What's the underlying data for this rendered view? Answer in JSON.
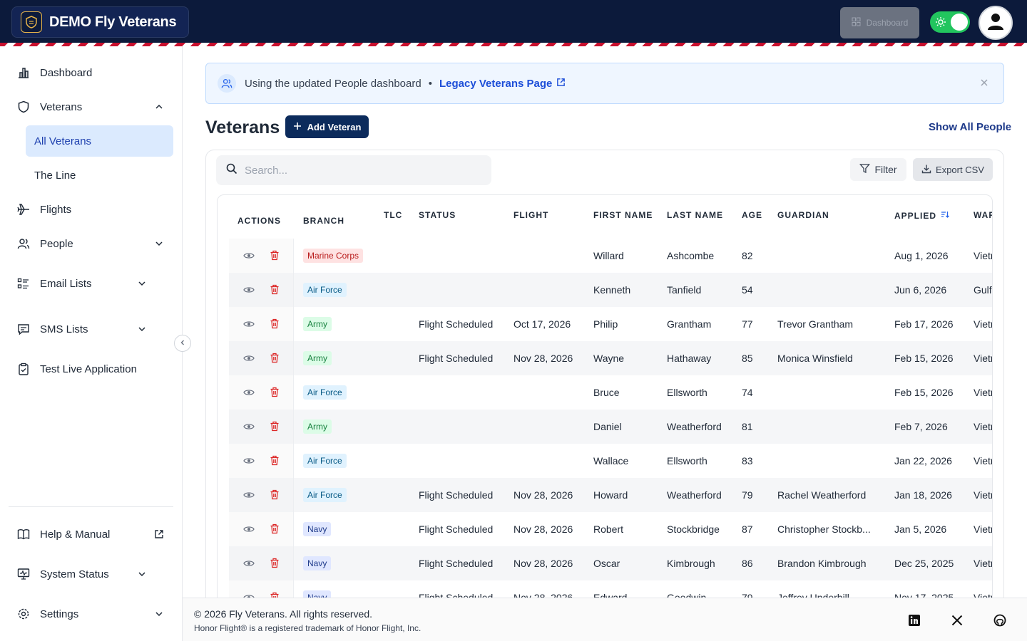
{
  "header": {
    "brand_title": "DEMO Fly Veterans",
    "dashboard_button": "Dashboard"
  },
  "sidebar": {
    "dashboard": "Dashboard",
    "veterans": "Veterans",
    "veterans_sub": [
      "All Veterans",
      "The Line"
    ],
    "flights": "Flights",
    "people": "People",
    "email_lists": "Email Lists",
    "sms_lists": "SMS Lists",
    "test_live": "Test Live Application",
    "help": "Help & Manual",
    "system_status": "System Status",
    "settings": "Settings"
  },
  "banner": {
    "text": "Using the updated People dashboard",
    "separator": "•",
    "link": "Legacy Veterans Page"
  },
  "page": {
    "title": "Veterans",
    "add_button": "Add Veteran",
    "show_all": "Show All People"
  },
  "toolbar": {
    "search_placeholder": "Search...",
    "filter": "Filter",
    "export": "Export CSV"
  },
  "table": {
    "headers": {
      "actions": "ACTIONS",
      "branch": "BRANCH",
      "tlc": "TLC",
      "status": "STATUS",
      "flight": "FLIGHT",
      "first": "FIRST NAME",
      "last": "LAST NAME",
      "age": "AGE",
      "guardian": "GUARDIAN",
      "applied": "APPLIED",
      "war": "WAR"
    },
    "rows": [
      {
        "branch": "Marine Corps",
        "status": "",
        "flight": "",
        "first": "Willard",
        "last": "Ashcombe",
        "age": "82",
        "guardian": "",
        "applied": "Aug 1, 2026",
        "war": "Vietnam"
      },
      {
        "branch": "Air Force",
        "status": "",
        "flight": "",
        "first": "Kenneth",
        "last": "Tanfield",
        "age": "54",
        "guardian": "",
        "applied": "Jun 6, 2026",
        "war": "Gulf"
      },
      {
        "branch": "Army",
        "status": "Flight Scheduled",
        "flight": "Oct 17, 2026",
        "first": "Philip",
        "last": "Grantham",
        "age": "77",
        "guardian": "Trevor Grantham",
        "applied": "Feb 17, 2026",
        "war": "Vietnam"
      },
      {
        "branch": "Army",
        "status": "Flight Scheduled",
        "flight": "Nov 28, 2026",
        "first": "Wayne",
        "last": "Hathaway",
        "age": "85",
        "guardian": "Monica Winsfield",
        "applied": "Feb 15, 2026",
        "war": "Vietnam"
      },
      {
        "branch": "Air Force",
        "status": "",
        "flight": "",
        "first": "Bruce",
        "last": "Ellsworth",
        "age": "74",
        "guardian": "",
        "applied": "Feb 15, 2026",
        "war": "Vietnam"
      },
      {
        "branch": "Army",
        "status": "",
        "flight": "",
        "first": "Daniel",
        "last": "Weatherford",
        "age": "81",
        "guardian": "",
        "applied": "Feb 7, 2026",
        "war": "Vietnam"
      },
      {
        "branch": "Air Force",
        "status": "",
        "flight": "",
        "first": "Wallace",
        "last": "Ellsworth",
        "age": "83",
        "guardian": "",
        "applied": "Jan 22, 2026",
        "war": "Vietnam"
      },
      {
        "branch": "Air Force",
        "status": "Flight Scheduled",
        "flight": "Nov 28, 2026",
        "first": "Howard",
        "last": "Weatherford",
        "age": "79",
        "guardian": "Rachel Weatherford",
        "applied": "Jan 18, 2026",
        "war": "Vietnam"
      },
      {
        "branch": "Navy",
        "status": "Flight Scheduled",
        "flight": "Nov 28, 2026",
        "first": "Robert",
        "last": "Stockbridge",
        "age": "87",
        "guardian": "Christopher Stockb...",
        "applied": "Jan 5, 2026",
        "war": "Vietnam"
      },
      {
        "branch": "Navy",
        "status": "Flight Scheduled",
        "flight": "Nov 28, 2026",
        "first": "Oscar",
        "last": "Kimbrough",
        "age": "86",
        "guardian": "Brandon Kimbrough",
        "applied": "Dec 25, 2025",
        "war": "Vietnam"
      },
      {
        "branch": "Navy",
        "status": "Flight Scheduled",
        "flight": "Nov 28, 2026",
        "first": "Edward",
        "last": "Goodwin",
        "age": "79",
        "guardian": "Jeffrey Underhill",
        "applied": "Nov 17, 2025",
        "war": "Vietnam"
      }
    ]
  },
  "footer": {
    "copyright": "© 2026 Fly Veterans. All rights reserved.",
    "trademark": "Honor Flight® is a registered trademark of Honor Flight, Inc."
  },
  "icons": [
    "shield-logo-icon",
    "dashboard-grid-icon",
    "sun-icon",
    "user-icon",
    "chart-icon",
    "shield-icon",
    "plane-icon",
    "people-icon",
    "list-icon",
    "message-icon",
    "clipboard-icon",
    "book-icon",
    "external-link-icon",
    "monitor-icon",
    "gear-icon",
    "chevron-down-icon",
    "chevron-up-icon",
    "chevron-left-icon",
    "close-icon",
    "plus-icon",
    "search-icon",
    "filter-icon",
    "download-icon",
    "eye-icon",
    "trash-icon",
    "sort-icon",
    "linkedin-icon",
    "x-icon",
    "github-icon"
  ],
  "colors": {
    "navy": "#0c1a3b",
    "accent_red": "#c8102e",
    "primary": "#0c2b5c",
    "link": "#1d4ed8",
    "success": "#22c55e",
    "danger": "#dc2626"
  }
}
